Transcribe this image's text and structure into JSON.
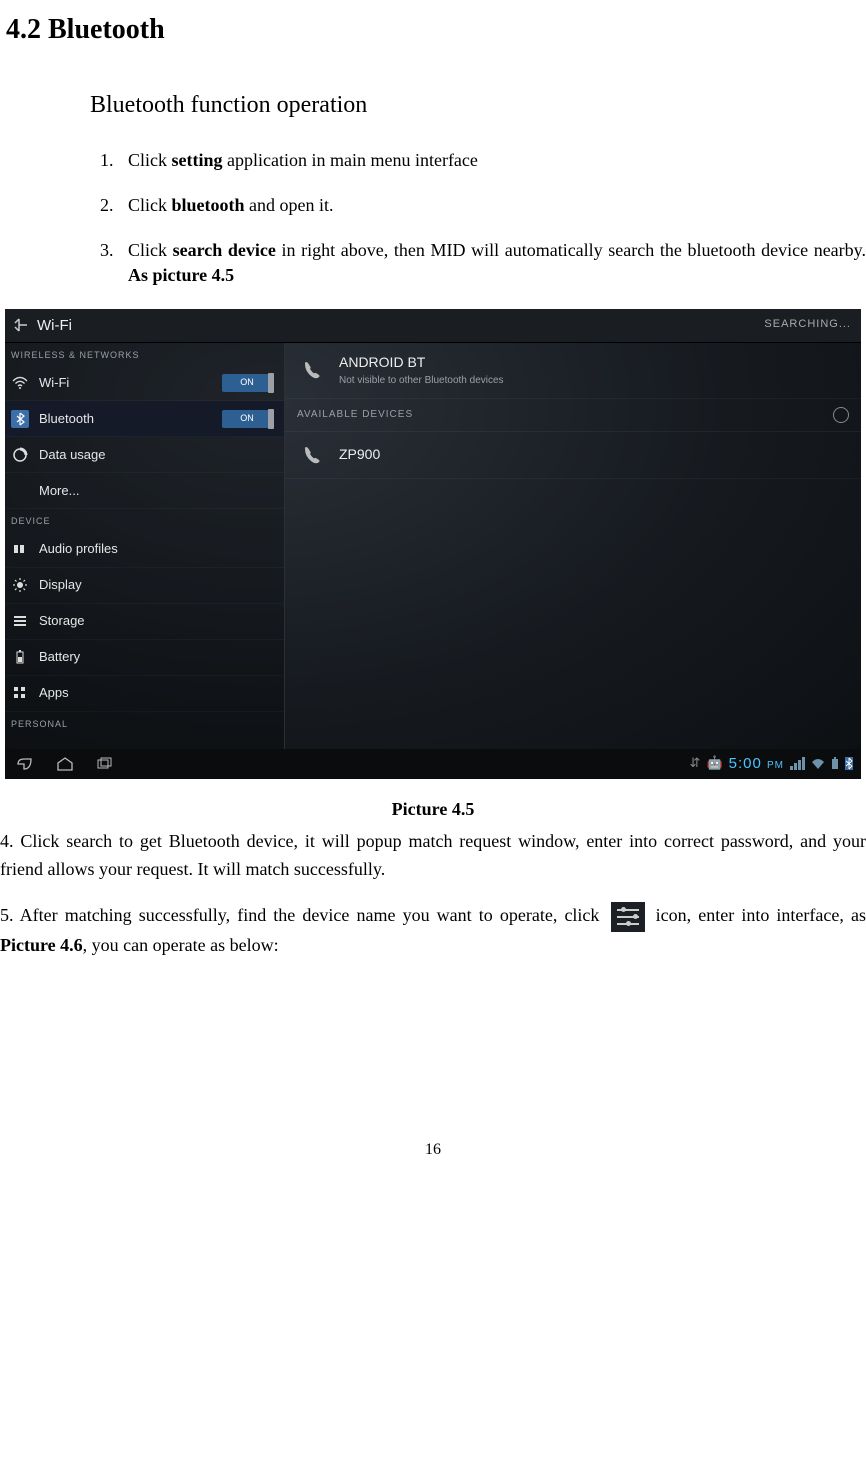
{
  "heading": "4.2 Bluetooth",
  "subheading": "Bluetooth function operation",
  "steps": [
    {
      "pre": "Click ",
      "bold": "setting",
      "post": " application in main menu interface"
    },
    {
      "pre": "Click ",
      "bold": "bluetooth",
      "post": " and open it."
    },
    {
      "pre": "Click ",
      "bold": "search device",
      "post": " in right above, then MID will automatically search the bluetooth device nearby. ",
      "bold2": "As picture 4.5"
    }
  ],
  "screenshot": {
    "header_title": "Wi-Fi",
    "header_right": "SEARCHING...",
    "sidebar_sections": {
      "networks": "WIRELESS & NETWORKS",
      "device": "DEVICE",
      "personal": "PERSONAL"
    },
    "sidebar_items": {
      "wifi": "Wi-Fi",
      "bluetooth": "Bluetooth",
      "data_usage": "Data usage",
      "more": "More...",
      "audio": "Audio profiles",
      "display": "Display",
      "storage": "Storage",
      "battery": "Battery",
      "apps": "Apps"
    },
    "toggle_on": "ON",
    "main": {
      "device_name": "ANDROID BT",
      "device_sub": "Not visible to other Bluetooth devices",
      "available_header": "AVAILABLE DEVICES",
      "available_device": "ZP900"
    },
    "navbar": {
      "time": "5:00",
      "ampm": "PM"
    }
  },
  "caption": "Picture 4.5",
  "para4": "4. Click search to get Bluetooth device, it will popup match request window, enter into correct password, and your friend allows your request. It will match successfully.",
  "para5_pre": "5. After matching successfully, find the device name you want to operate, click ",
  "para5_post": " icon, enter into interface, as ",
  "para5_bold": "Picture 4.6",
  "para5_tail": ", you can operate as below:",
  "page_number": "16"
}
